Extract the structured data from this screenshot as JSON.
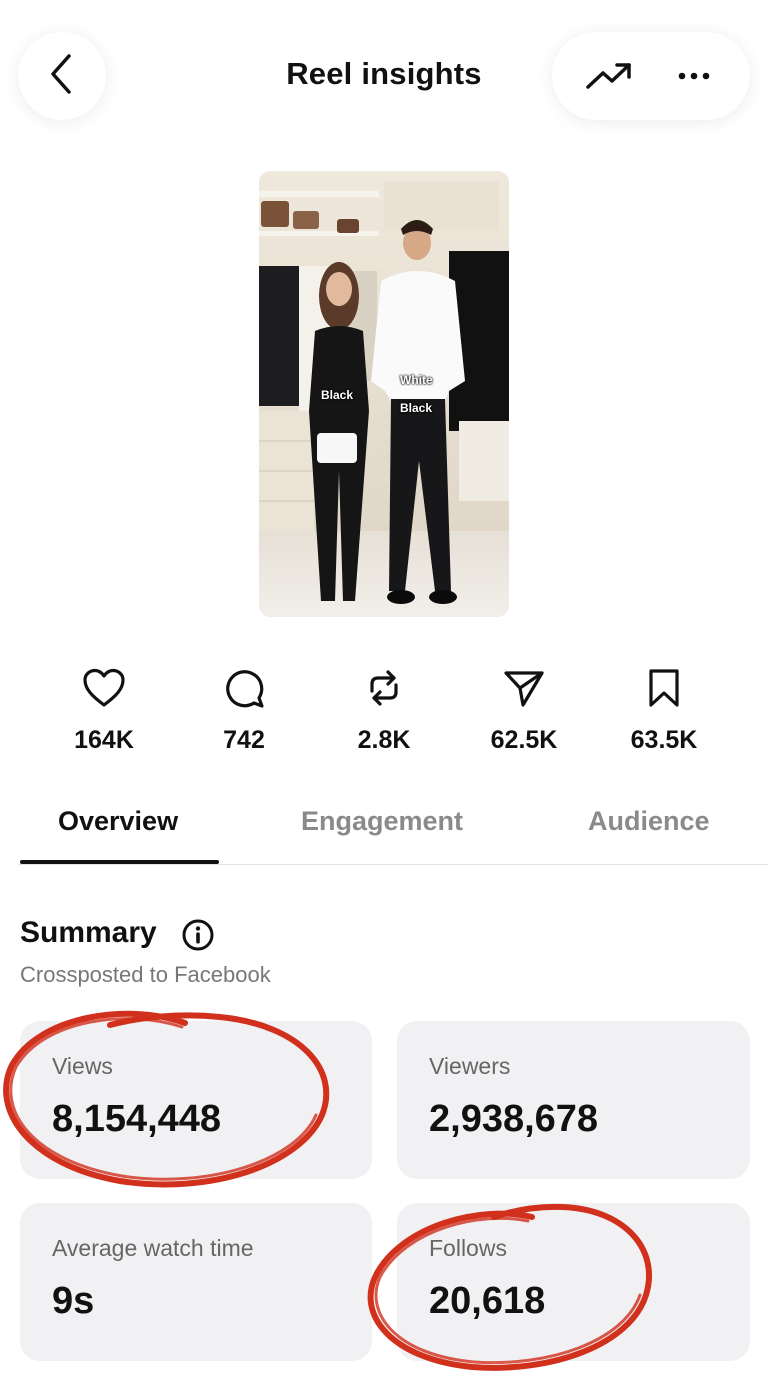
{
  "header": {
    "title": "Reel insights",
    "back_icon": "chevron-left-icon",
    "trend_icon": "trending-up-icon",
    "more_icon": "more-horizontal-icon"
  },
  "thumbnail": {
    "overlay_left": "Black",
    "overlay_right_top": "White",
    "overlay_right_bottom": "Black"
  },
  "metrics": [
    {
      "icon": "heart-icon",
      "value": "164K"
    },
    {
      "icon": "comment-icon",
      "value": "742"
    },
    {
      "icon": "repost-icon",
      "value": "2.8K"
    },
    {
      "icon": "send-icon",
      "value": "62.5K"
    },
    {
      "icon": "bookmark-icon",
      "value": "63.5K"
    }
  ],
  "tabs": [
    {
      "label": "Overview",
      "active": true
    },
    {
      "label": "Engagement",
      "active": false
    },
    {
      "label": "Audience",
      "active": false
    }
  ],
  "summary": {
    "title": "Summary",
    "subtitle": "Crossposted to Facebook",
    "cards": [
      {
        "label": "Views",
        "value": "8,154,448"
      },
      {
        "label": "Viewers",
        "value": "2,938,678"
      },
      {
        "label": "Average watch time",
        "value": "9s"
      },
      {
        "label": "Follows",
        "value": "20,618"
      }
    ]
  },
  "colors": {
    "accent_text": "#111111",
    "muted_text": "#8a8a8a",
    "card_bg": "#f1f1f4",
    "annotation_red": "#d1301c"
  }
}
